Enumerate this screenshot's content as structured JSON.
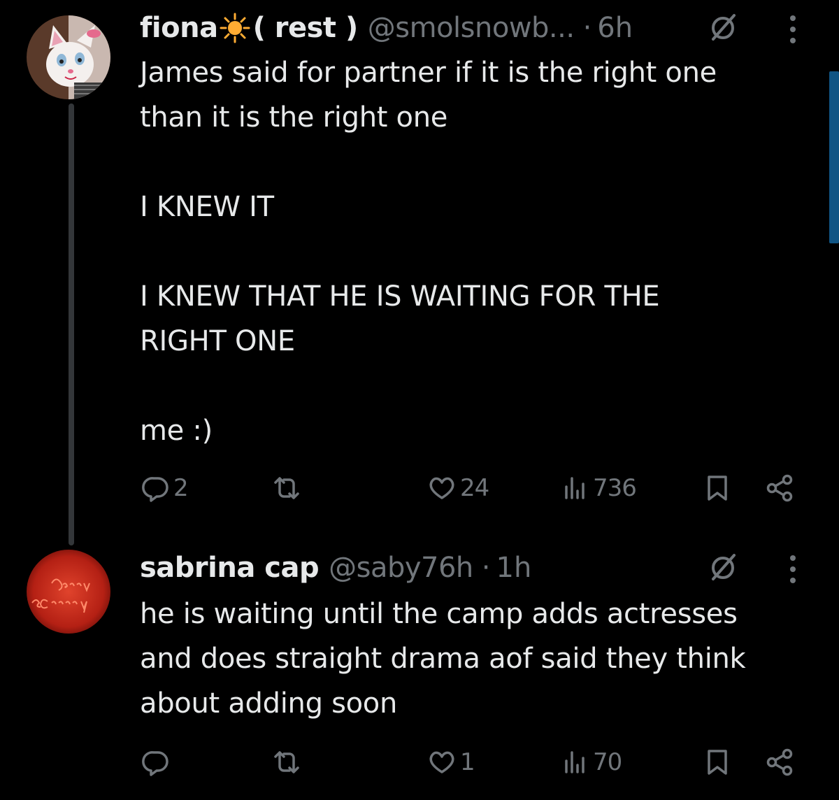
{
  "tweets": [
    {
      "display_name": "fiona",
      "name_suffix": " ( rest )",
      "handle": "@smolsnowb...",
      "time": "6h",
      "text": "James said for partner if it is the right one\nthan it is the right one\n\nI KNEW IT\n\nI KNEW THAT HE IS WAITING FOR THE\nRIGHT ONE\n\nme :)",
      "replies": "2",
      "retweets": "",
      "likes": "24",
      "views": "736"
    },
    {
      "display_name": "sabrina cap",
      "handle": "@saby76h",
      "time": "1h",
      "text": "he is waiting until the camp adds actresses\nand does straight drama aof said they think\nabout adding soon",
      "replies": "",
      "retweets": "",
      "likes": "1",
      "views": "70",
      "avatar_lettering": "Sassy & Classy"
    }
  ],
  "icons": {
    "name_emoji": "sun-emoji-icon",
    "grok": "grok-slash-icon",
    "more": "more-vertical-icon",
    "reply": "reply-icon",
    "retweet": "retweet-icon",
    "like": "heart-icon",
    "views": "views-bar-chart-icon",
    "bookmark": "bookmark-icon",
    "share": "share-icon"
  },
  "colors": {
    "background": "#000000",
    "text_primary": "#e7e9ea",
    "text_secondary": "#71767b",
    "thread_line": "#333639",
    "sun_yellow": "#ffac33",
    "accent_blue": "#1d9bf0"
  }
}
